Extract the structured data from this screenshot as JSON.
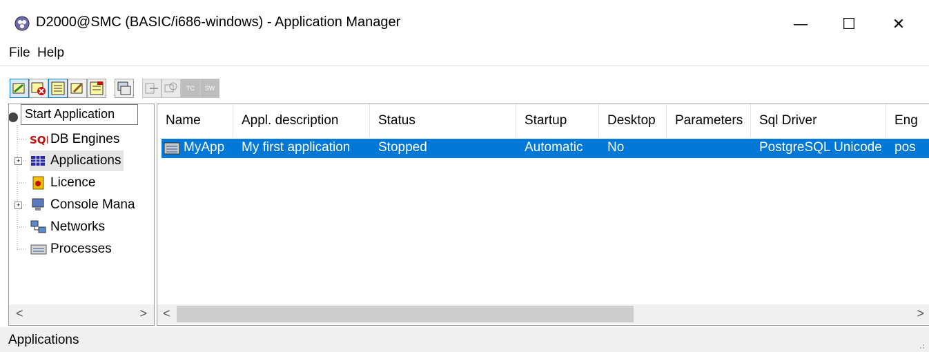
{
  "window": {
    "title": "D2000@SMC (BASIC/i686-windows) - Application Manager",
    "minimize_glyph": "—",
    "maximize_glyph": "☐",
    "close_glyph": "✕"
  },
  "menu": {
    "items": [
      "File",
      "Help"
    ]
  },
  "toolbar": {
    "buttons": [
      {
        "icon": "start-application-icon",
        "state": "active"
      },
      {
        "icon": "stop-application-icon",
        "state": "normal"
      },
      {
        "icon": "application-properties-icon",
        "state": "active"
      },
      {
        "icon": "edit-application-icon",
        "state": "normal"
      },
      {
        "icon": "delete-application-icon",
        "state": "normal"
      },
      {
        "icon": "console-icon",
        "state": "normal"
      },
      {
        "icon": "tool-disabled-1-icon",
        "state": "disabled"
      },
      {
        "icon": "tool-disabled-2-icon",
        "state": "disabled"
      },
      {
        "icon": "tc-icon",
        "state": "disabled",
        "text": "TC"
      },
      {
        "icon": "sw-icon",
        "state": "disabled",
        "text": "SW"
      }
    ],
    "tooltip": "Start Application"
  },
  "tree": {
    "items": [
      {
        "label": "DB Engines",
        "icon": "db-engines-icon"
      },
      {
        "label": "Applications",
        "icon": "applications-icon"
      },
      {
        "label": "Licence",
        "icon": "licence-icon"
      },
      {
        "label": "Console Mana",
        "icon": "console-manager-icon"
      },
      {
        "label": "Networks",
        "icon": "networks-icon"
      },
      {
        "label": "Processes",
        "icon": "processes-icon"
      }
    ]
  },
  "table": {
    "columns": [
      "Name",
      "Appl. description",
      "Status",
      "Startup",
      "Desktop",
      "Parameters",
      "Sql Driver",
      "Eng"
    ],
    "rows": [
      [
        "MyApp",
        "My first application",
        "Stopped",
        "Automatic",
        "No",
        "",
        "PostgreSQL Unicode",
        "pos"
      ]
    ]
  },
  "scroll": {
    "left_glyph": "<",
    "right_glyph": ">"
  },
  "status": {
    "text": "Applications"
  },
  "colors": {
    "selection": "#0078d7",
    "toolbar_bg": "#f0f0f0"
  }
}
